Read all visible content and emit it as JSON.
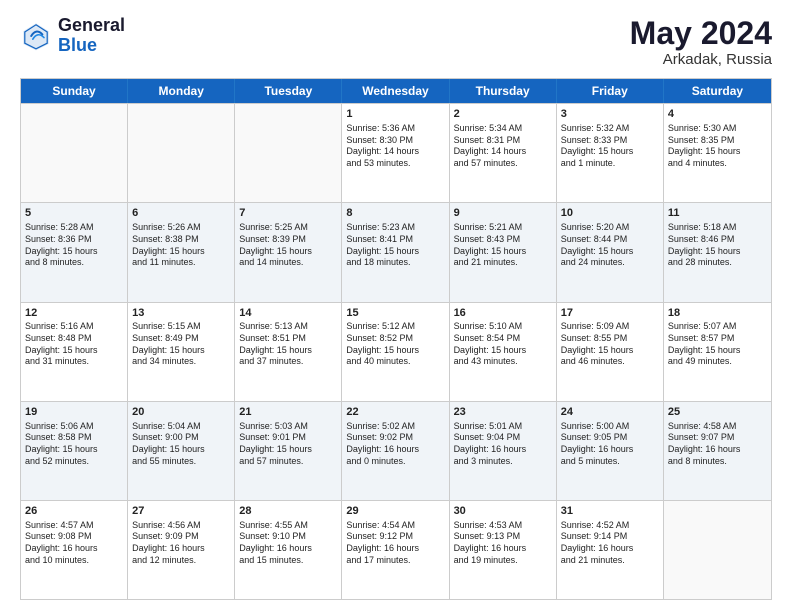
{
  "logo": {
    "line1": "General",
    "line2": "Blue"
  },
  "title": "May 2024",
  "subtitle": "Arkadak, Russia",
  "days": [
    "Sunday",
    "Monday",
    "Tuesday",
    "Wednesday",
    "Thursday",
    "Friday",
    "Saturday"
  ],
  "weeks": [
    [
      {
        "day": "",
        "lines": []
      },
      {
        "day": "",
        "lines": []
      },
      {
        "day": "",
        "lines": []
      },
      {
        "day": "1",
        "lines": [
          "Sunrise: 5:36 AM",
          "Sunset: 8:30 PM",
          "Daylight: 14 hours",
          "and 53 minutes."
        ]
      },
      {
        "day": "2",
        "lines": [
          "Sunrise: 5:34 AM",
          "Sunset: 8:31 PM",
          "Daylight: 14 hours",
          "and 57 minutes."
        ]
      },
      {
        "day": "3",
        "lines": [
          "Sunrise: 5:32 AM",
          "Sunset: 8:33 PM",
          "Daylight: 15 hours",
          "and 1 minute."
        ]
      },
      {
        "day": "4",
        "lines": [
          "Sunrise: 5:30 AM",
          "Sunset: 8:35 PM",
          "Daylight: 15 hours",
          "and 4 minutes."
        ]
      }
    ],
    [
      {
        "day": "5",
        "lines": [
          "Sunrise: 5:28 AM",
          "Sunset: 8:36 PM",
          "Daylight: 15 hours",
          "and 8 minutes."
        ]
      },
      {
        "day": "6",
        "lines": [
          "Sunrise: 5:26 AM",
          "Sunset: 8:38 PM",
          "Daylight: 15 hours",
          "and 11 minutes."
        ]
      },
      {
        "day": "7",
        "lines": [
          "Sunrise: 5:25 AM",
          "Sunset: 8:39 PM",
          "Daylight: 15 hours",
          "and 14 minutes."
        ]
      },
      {
        "day": "8",
        "lines": [
          "Sunrise: 5:23 AM",
          "Sunset: 8:41 PM",
          "Daylight: 15 hours",
          "and 18 minutes."
        ]
      },
      {
        "day": "9",
        "lines": [
          "Sunrise: 5:21 AM",
          "Sunset: 8:43 PM",
          "Daylight: 15 hours",
          "and 21 minutes."
        ]
      },
      {
        "day": "10",
        "lines": [
          "Sunrise: 5:20 AM",
          "Sunset: 8:44 PM",
          "Daylight: 15 hours",
          "and 24 minutes."
        ]
      },
      {
        "day": "11",
        "lines": [
          "Sunrise: 5:18 AM",
          "Sunset: 8:46 PM",
          "Daylight: 15 hours",
          "and 28 minutes."
        ]
      }
    ],
    [
      {
        "day": "12",
        "lines": [
          "Sunrise: 5:16 AM",
          "Sunset: 8:48 PM",
          "Daylight: 15 hours",
          "and 31 minutes."
        ]
      },
      {
        "day": "13",
        "lines": [
          "Sunrise: 5:15 AM",
          "Sunset: 8:49 PM",
          "Daylight: 15 hours",
          "and 34 minutes."
        ]
      },
      {
        "day": "14",
        "lines": [
          "Sunrise: 5:13 AM",
          "Sunset: 8:51 PM",
          "Daylight: 15 hours",
          "and 37 minutes."
        ]
      },
      {
        "day": "15",
        "lines": [
          "Sunrise: 5:12 AM",
          "Sunset: 8:52 PM",
          "Daylight: 15 hours",
          "and 40 minutes."
        ]
      },
      {
        "day": "16",
        "lines": [
          "Sunrise: 5:10 AM",
          "Sunset: 8:54 PM",
          "Daylight: 15 hours",
          "and 43 minutes."
        ]
      },
      {
        "day": "17",
        "lines": [
          "Sunrise: 5:09 AM",
          "Sunset: 8:55 PM",
          "Daylight: 15 hours",
          "and 46 minutes."
        ]
      },
      {
        "day": "18",
        "lines": [
          "Sunrise: 5:07 AM",
          "Sunset: 8:57 PM",
          "Daylight: 15 hours",
          "and 49 minutes."
        ]
      }
    ],
    [
      {
        "day": "19",
        "lines": [
          "Sunrise: 5:06 AM",
          "Sunset: 8:58 PM",
          "Daylight: 15 hours",
          "and 52 minutes."
        ]
      },
      {
        "day": "20",
        "lines": [
          "Sunrise: 5:04 AM",
          "Sunset: 9:00 PM",
          "Daylight: 15 hours",
          "and 55 minutes."
        ]
      },
      {
        "day": "21",
        "lines": [
          "Sunrise: 5:03 AM",
          "Sunset: 9:01 PM",
          "Daylight: 15 hours",
          "and 57 minutes."
        ]
      },
      {
        "day": "22",
        "lines": [
          "Sunrise: 5:02 AM",
          "Sunset: 9:02 PM",
          "Daylight: 16 hours",
          "and 0 minutes."
        ]
      },
      {
        "day": "23",
        "lines": [
          "Sunrise: 5:01 AM",
          "Sunset: 9:04 PM",
          "Daylight: 16 hours",
          "and 3 minutes."
        ]
      },
      {
        "day": "24",
        "lines": [
          "Sunrise: 5:00 AM",
          "Sunset: 9:05 PM",
          "Daylight: 16 hours",
          "and 5 minutes."
        ]
      },
      {
        "day": "25",
        "lines": [
          "Sunrise: 4:58 AM",
          "Sunset: 9:07 PM",
          "Daylight: 16 hours",
          "and 8 minutes."
        ]
      }
    ],
    [
      {
        "day": "26",
        "lines": [
          "Sunrise: 4:57 AM",
          "Sunset: 9:08 PM",
          "Daylight: 16 hours",
          "and 10 minutes."
        ]
      },
      {
        "day": "27",
        "lines": [
          "Sunrise: 4:56 AM",
          "Sunset: 9:09 PM",
          "Daylight: 16 hours",
          "and 12 minutes."
        ]
      },
      {
        "day": "28",
        "lines": [
          "Sunrise: 4:55 AM",
          "Sunset: 9:10 PM",
          "Daylight: 16 hours",
          "and 15 minutes."
        ]
      },
      {
        "day": "29",
        "lines": [
          "Sunrise: 4:54 AM",
          "Sunset: 9:12 PM",
          "Daylight: 16 hours",
          "and 17 minutes."
        ]
      },
      {
        "day": "30",
        "lines": [
          "Sunrise: 4:53 AM",
          "Sunset: 9:13 PM",
          "Daylight: 16 hours",
          "and 19 minutes."
        ]
      },
      {
        "day": "31",
        "lines": [
          "Sunrise: 4:52 AM",
          "Sunset: 9:14 PM",
          "Daylight: 16 hours",
          "and 21 minutes."
        ]
      },
      {
        "day": "",
        "lines": []
      }
    ]
  ]
}
